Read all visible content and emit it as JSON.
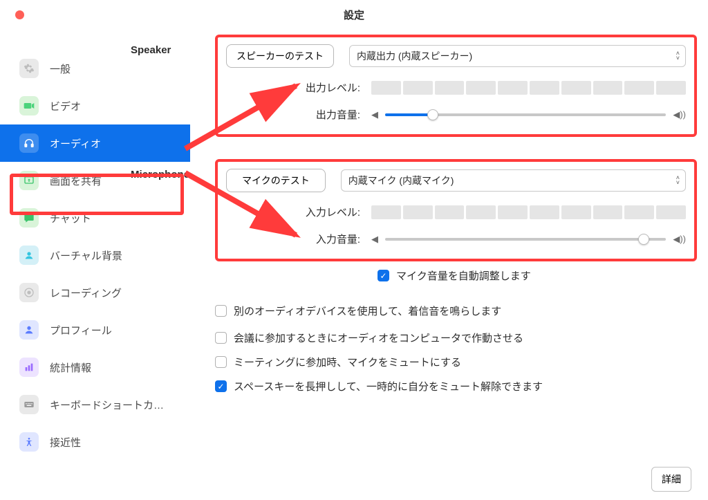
{
  "title": "設定",
  "sidebar": {
    "items": [
      {
        "label": "一般"
      },
      {
        "label": "ビデオ"
      },
      {
        "label": "オーディオ"
      },
      {
        "label": "画面を共有"
      },
      {
        "label": "チャット"
      },
      {
        "label": "バーチャル背景"
      },
      {
        "label": "レコーディング"
      },
      {
        "label": "プロフィール"
      },
      {
        "label": "統計情報"
      },
      {
        "label": "キーボードショートカ…"
      },
      {
        "label": "接近性"
      }
    ]
  },
  "speaker": {
    "heading": "Speaker",
    "test_btn": "スピーカーのテスト",
    "device": "内蔵出力 (内蔵スピーカー)",
    "output_level_label": "出力レベル:",
    "output_volume_label": "出力音量:",
    "volume_percent": 17
  },
  "microphone": {
    "heading": "Microphone",
    "test_btn": "マイクのテスト",
    "device": "内蔵マイク (内蔵マイク)",
    "input_level_label": "入力レベル:",
    "input_volume_label": "入力音量:",
    "volume_percent": 92,
    "auto_adjust": "マイク音量を自動調整します"
  },
  "option_separate_ringtone": "別のオーディオデバイスを使用して、着信音を鳴らします",
  "option_join_audio": "会議に参加するときにオーディオをコンピュータで作動させる",
  "option_mute_on_join": "ミーティングに参加時、マイクをミュートにする",
  "option_space_unmute": "スペースキーを長押しして、一時的に自分をミュート解除できます",
  "detail_btn": "詳細"
}
